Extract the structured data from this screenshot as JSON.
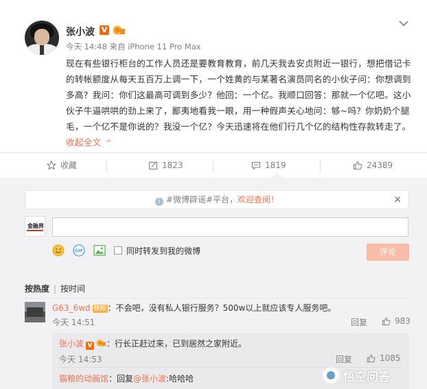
{
  "post": {
    "author": "张小波",
    "vip_badge": "V",
    "meta": "今天 14:48 来自 iPhone 11 Pro Max",
    "text": "现在有些银行柜台的工作人员还是要教育教育，前几天我去安贞附近一银行，想把借记卡的转帐额度从每天五百万上调一下，一个姓黄的与某著名演员同名的小伙子问：你想调到多高？我问：你们这最高可调到多少？他回：一个亿。我顺口回答：那就一个亿吧。这小伙子牛逼哄哄的劲上来了，鄙夷地看我一眼，用一种假声关心地问：够~吗？你奶奶个腿毛，一个亿不是你说的？我没一个亿？今天迅速将在他们行几个亿的结构性存款转走了。",
    "collapse_label": "收起全文",
    "collapse_chevron": "^"
  },
  "actions": {
    "favorite_label": "收藏",
    "repost_count": "1823",
    "comment_count": "1819",
    "like_count": "24389"
  },
  "notice": {
    "info_glyph": "i",
    "prefix": "#微博辟谣#平台，",
    "link": "欢迎查阅！",
    "close": "×"
  },
  "composer": {
    "my_avatar_text": "金融界",
    "input_value": "",
    "repost_label": "同时转发到我的微博",
    "submit_label": "评论",
    "gif_label": "GIF"
  },
  "sort": {
    "by_hot": "按热度",
    "by_time": "按时间"
  },
  "comments": [
    {
      "user": "G63_6wd",
      "badge": "铁粉",
      "text": "：不会吧，没有私人银行服务？500w以上就应该专人服务吧。",
      "time": "今天 14:51",
      "reply": "回复",
      "likes": "983"
    }
  ],
  "replies": [
    {
      "user": "张小波",
      "badge": "V",
      "text": "：行长正赶过来，已到居然之家附近。",
      "time": "今天 14:53",
      "reply": "回复",
      "likes": "1085"
    },
    {
      "user": "猫粮的动画馆",
      "text_prefix": "：回复",
      "mention": "@张小波",
      "text_suffix": ":哈哈哈"
    }
  ],
  "watermark": "悟空问答",
  "colors": {
    "accent": "#eb7350",
    "vip": "#e86f11",
    "muted": "#808080",
    "comment_bg": "#f2f2f5"
  }
}
